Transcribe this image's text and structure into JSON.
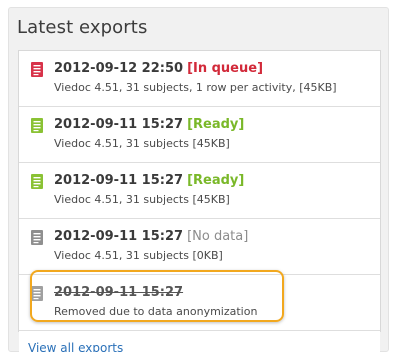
{
  "panel": {
    "title": "Latest exports"
  },
  "exports": [
    {
      "timestamp": "2012-09-12 22:50",
      "status": "[In queue]",
      "status_color": "#d22a3a",
      "icon": "document-icon",
      "icon_color": "#d8334a",
      "description": "Viedoc 4.51, 31 subjects, 1 row per activity, [45KB]"
    },
    {
      "timestamp": "2012-09-11 15:27",
      "status": "[Ready]",
      "status_color": "#7ab829",
      "icon": "document-icon",
      "icon_color": "#8ac234",
      "description": "Viedoc 4.51, 31 subjects [45KB]"
    },
    {
      "timestamp": "2012-09-11 15:27",
      "status": "[Ready]",
      "status_color": "#7ab829",
      "icon": "document-icon",
      "icon_color": "#8ac234",
      "description": "Viedoc 4.51, 31 subjects [45KB]"
    },
    {
      "timestamp": "2012-09-11 15:27",
      "status": "[No data]",
      "status_color": "#8c8c8c",
      "icon": "document-icon",
      "icon_color": "#8f8f8f",
      "description": "Viedoc 4.51, 31 subjects [0KB]"
    },
    {
      "timestamp": "2012-09-11 15:27",
      "status": "",
      "icon": "document-icon",
      "icon_color": "#a0a0a0",
      "description": "Removed due to data anonymization",
      "struck": true,
      "highlighted": true
    }
  ],
  "footer": {
    "link_label": "View all exports",
    "link_color": "#2a70b8"
  },
  "highlight_color": "#f2a81e"
}
